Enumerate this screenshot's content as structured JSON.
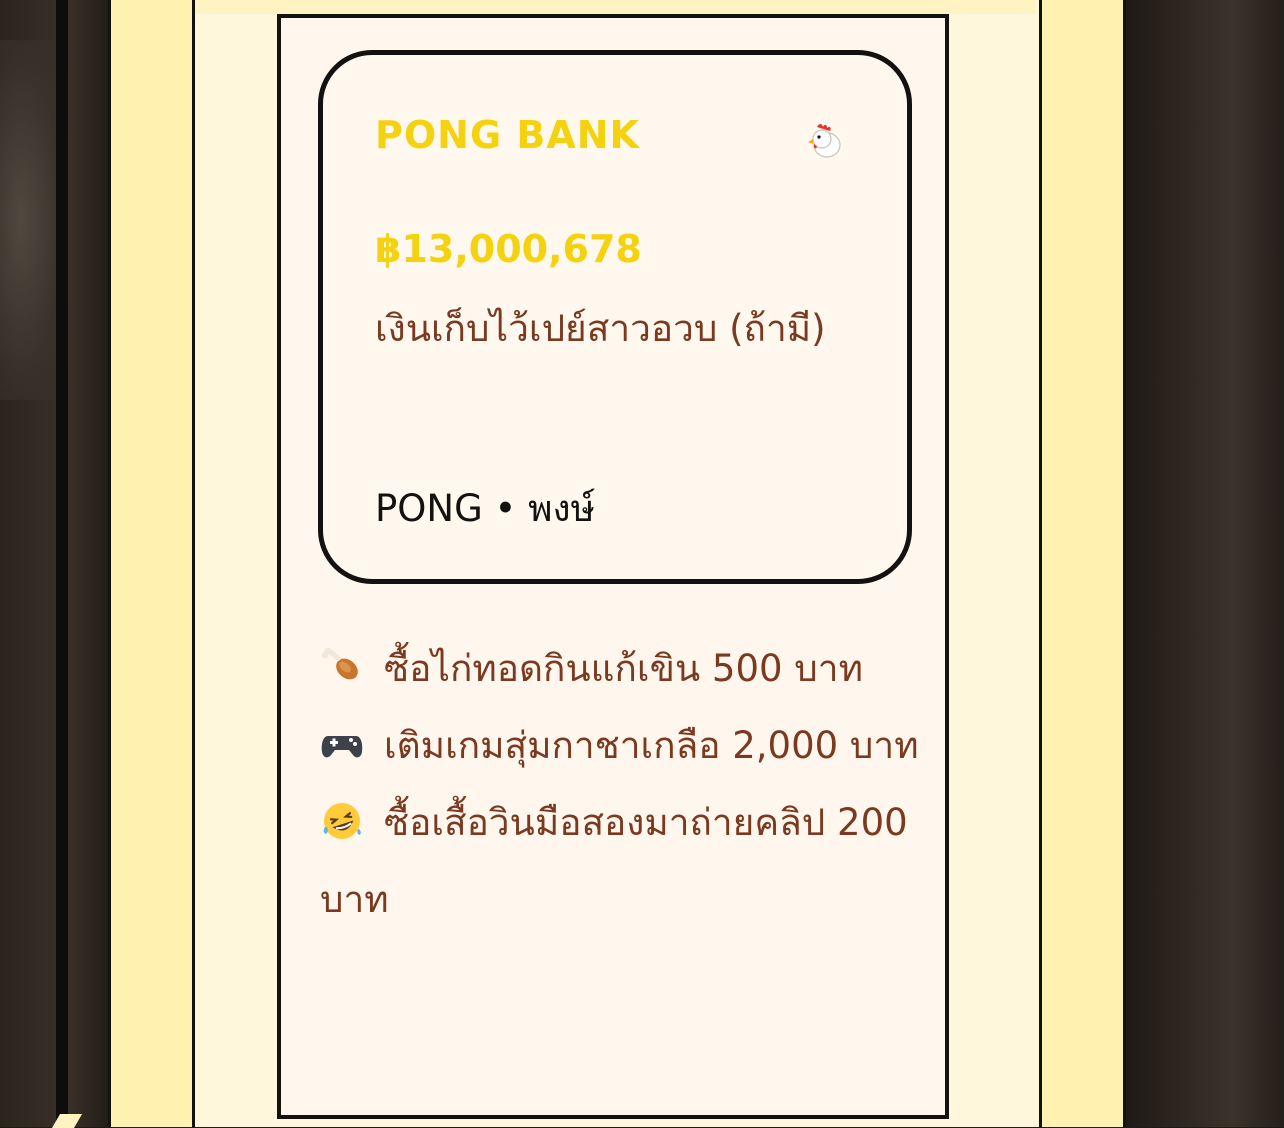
{
  "card": {
    "bank_name": "PONG BANK",
    "icon": "chicken-icon",
    "amount": "฿13,000,678",
    "description": "เงินเก็บไว้เปย์สาวอวบ (ถ้ามี)",
    "owner": "PONG • พงษ์"
  },
  "expenses": [
    {
      "icon": "drumstick-icon",
      "text": "ซื้อไก่ทอดกินแก้เขิน 500 บาท"
    },
    {
      "icon": "gamepad-icon",
      "text": "เติมเกมสุ่มกาชาเกลือ 2,000 บาท"
    },
    {
      "icon": "laughing-face-icon",
      "text": "ซื้อเสื้อวินมือสองมาถ่ายคลิป 200 บาท"
    }
  ],
  "colors": {
    "accent_yellow": "#f5d20f",
    "text_brown": "#7a3a20",
    "panel_bg": "#fff7ee",
    "frame_yellow": "#fff1b0",
    "border": "#141210"
  }
}
